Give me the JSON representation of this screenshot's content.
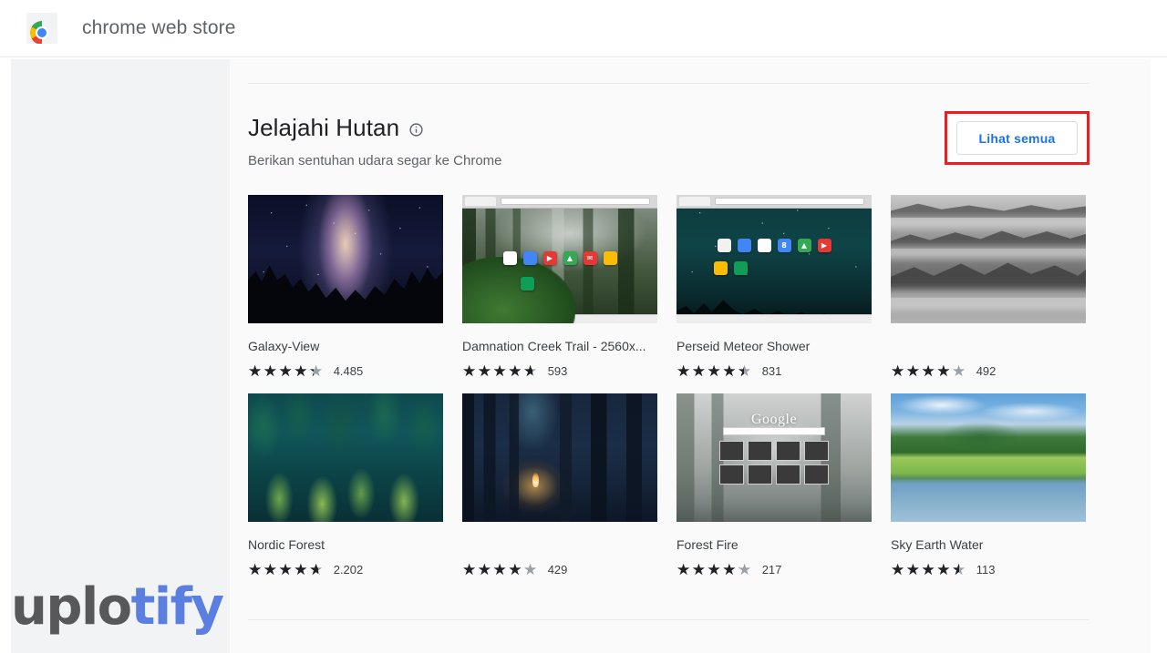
{
  "topbar": {
    "logo_icon": "chrome-logo-icon",
    "title": "chrome web store"
  },
  "section": {
    "title": "Jelajahi Hutan",
    "info_icon": "info-icon",
    "subtitle": "Berikan sentuhan udara segar ke Chrome",
    "see_all_label": "Lihat semua",
    "highlight_color": "#e62020",
    "link_color": "#1a73e8"
  },
  "items": [
    {
      "title": "Galaxy-View",
      "rating": 4.3,
      "rating_count": "4.485",
      "art": "galaxy"
    },
    {
      "title": "Damnation Creek Trail - 2560x...",
      "rating": 4.6,
      "rating_count": "593",
      "art": "misty-forest-browser"
    },
    {
      "title": "Perseid Meteor Shower",
      "rating": 4.4,
      "rating_count": "831",
      "art": "teal-night-browser"
    },
    {
      "title": "",
      "rating": 4.0,
      "rating_count": "492",
      "art": "gray-mist"
    },
    {
      "title": "Nordic Forest",
      "rating": 4.6,
      "rating_count": "2.202",
      "art": "pine-forest"
    },
    {
      "title": "",
      "rating": 4.0,
      "rating_count": "429",
      "art": "dark-wood-campfire"
    },
    {
      "title": "Forest Fire",
      "rating": 4.1,
      "rating_count": "217",
      "art": "google-ntp-fog"
    },
    {
      "title": "Sky Earth Water",
      "rating": 4.5,
      "rating_count": "113",
      "art": "lake-hills"
    }
  ],
  "thumb_widgets": {
    "ntp_logo_text": "Google",
    "app_icons_row1": [
      {
        "name": "chrome-app-icon",
        "glyph": "",
        "color": "#ffffff"
      },
      {
        "name": "docs-app-icon",
        "glyph": "",
        "color": "#4285f4"
      },
      {
        "name": "youtube-app-icon",
        "glyph": "▶",
        "color": "#e53935"
      },
      {
        "name": "drive-app-icon",
        "glyph": "▲",
        "color": "#34a853"
      },
      {
        "name": "gmail-app-icon",
        "glyph": "✉",
        "color": "#e53935"
      },
      {
        "name": "keep-app-icon",
        "glyph": "",
        "color": "#fbbc05"
      }
    ],
    "app_icons_row2": [
      {
        "name": "sheets-app-icon",
        "glyph": "",
        "color": "#0f9d58"
      }
    ],
    "app_icons_p1": [
      {
        "name": "photos-app-icon",
        "glyph": "",
        "color": "#f1f1f1"
      },
      {
        "name": "docs-app-icon",
        "glyph": "",
        "color": "#4285f4"
      },
      {
        "name": "gmail-app-icon",
        "glyph": "✉",
        "color": "#ffffff"
      },
      {
        "name": "calendar-app-icon",
        "glyph": "8",
        "color": "#4285f4"
      },
      {
        "name": "drive-app-icon",
        "glyph": "▲",
        "color": "#34a853"
      },
      {
        "name": "youtube-app-icon",
        "glyph": "▶",
        "color": "#e53935"
      }
    ],
    "app_icons_p2": [
      {
        "name": "slides-app-icon",
        "glyph": "",
        "color": "#fbbc05"
      },
      {
        "name": "sheets-app-icon",
        "glyph": "",
        "color": "#0f9d58"
      }
    ]
  },
  "watermark": {
    "part_a": "uplo",
    "part_b": "tify"
  }
}
